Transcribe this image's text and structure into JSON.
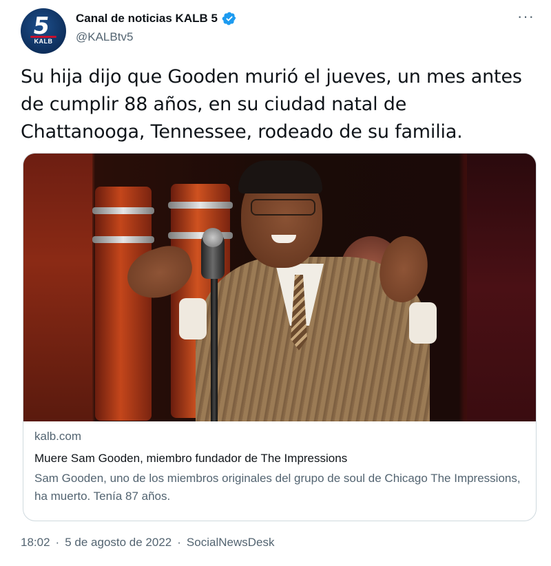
{
  "account": {
    "avatar_text": "5",
    "avatar_brand": "KALB",
    "display_name": "Canal de noticias KALB 5",
    "handle": "@KALBtv5",
    "verified": true,
    "more_icon": "···"
  },
  "tweet": {
    "text": "Su hija dijo que Gooden murió el jueves, un mes antes de cumplir 88 años, en su ciudad natal de Chattanooga, Tennessee, rodeado de su familia."
  },
  "card": {
    "domain": "kalb.com",
    "title": "Muere Sam Gooden, miembro fundador de The Impressions",
    "description": "Sam Gooden, uno de los miembros originales del grupo de soul de Chicago The Impressions, ha muerto. Tenía 87 años."
  },
  "meta": {
    "time": "18:02",
    "separator": "·",
    "date": "5 de agosto de 2022",
    "source": "SocialNewsDesk"
  },
  "colors": {
    "verified_badge": "#1d9bf0",
    "secondary_text": "#536471",
    "primary_text": "#0f1419",
    "border": "#cfd9de"
  }
}
